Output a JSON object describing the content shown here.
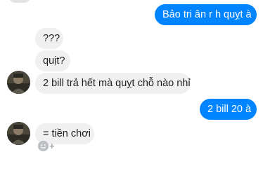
{
  "colors": {
    "outgoing_bubble": "#0084ff",
    "outgoing_text": "#ffffff",
    "incoming_bubble": "#f1f0f0",
    "incoming_text": "#1c1e21"
  },
  "messages": [
    {
      "direction": "outgoing",
      "text": "Bảo tri ân r h quỵt à"
    },
    {
      "direction": "incoming",
      "text": "???"
    },
    {
      "direction": "incoming",
      "text": "quịt?"
    },
    {
      "direction": "incoming",
      "text": "2 bill trả hết mà quỵt chỗ nào nhỉ"
    },
    {
      "direction": "outgoing",
      "text": "2 bill 20 à"
    },
    {
      "direction": "incoming",
      "text": "= tiền chơi"
    }
  ],
  "icons": {
    "avatar": "contact-avatar",
    "reaction": "add-reaction-icon"
  }
}
